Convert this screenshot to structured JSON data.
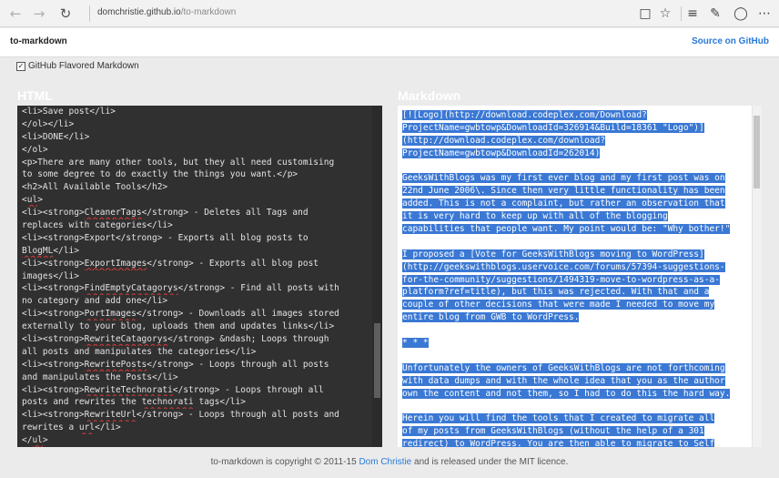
{
  "browser": {
    "address_domain": "domchristie.github.io",
    "address_path": "/to-markdown",
    "icons": [
      "back-arrow-icon",
      "forward-arrow-icon",
      "refresh-icon",
      "reading-view-icon",
      "favorite-star-icon",
      "hub-icon",
      "web-note-icon",
      "share-icon",
      "more-icon"
    ]
  },
  "header": {
    "title": "to-markdown",
    "source_link": "Source on GitHub"
  },
  "options": {
    "gfm_label": "GitHub Flavored Markdown",
    "gfm_checked": true
  },
  "html_panel": {
    "heading": "HTML",
    "lines": [
      [
        {
          "t": "<li>Save post</li>"
        }
      ],
      [
        {
          "t": "</ol></li>"
        }
      ],
      [
        {
          "t": "<li>DONE</li>"
        }
      ],
      [
        {
          "t": "</ol>"
        }
      ],
      [
        {
          "t": "<p>There are many other tools, but they all need customising"
        }
      ],
      [
        {
          "t": "to some degree to do exactly the things you want.</p>"
        }
      ],
      [
        {
          "t": "<h2>All Available Tools</h2>"
        }
      ],
      [
        {
          "t": "<"
        },
        {
          "t": "ul",
          "u": true
        },
        {
          "t": ">"
        }
      ],
      [
        {
          "t": "<li><strong>"
        },
        {
          "t": "CleanerTags",
          "u": true
        },
        {
          "t": "</strong> - Deletes all Tags and"
        }
      ],
      [
        {
          "t": "replaces with categories</li>"
        }
      ],
      [
        {
          "t": "<li><strong>Export</strong> - Exports all blog posts to"
        }
      ],
      [
        {
          "t": "BlogML",
          "u": true
        },
        {
          "t": "</li>"
        }
      ],
      [
        {
          "t": "<li><strong>"
        },
        {
          "t": "ExportImages",
          "u": true
        },
        {
          "t": "</strong> - Exports all blog post"
        }
      ],
      [
        {
          "t": "images</li>"
        }
      ],
      [
        {
          "t": "<li><strong>"
        },
        {
          "t": "FindEmptyCatagorys",
          "u": true
        },
        {
          "t": "</strong> - Find all posts with"
        }
      ],
      [
        {
          "t": "no category and add one</li>"
        }
      ],
      [
        {
          "t": "<li><strong>"
        },
        {
          "t": "PortImages",
          "u": true
        },
        {
          "t": "</strong> - Downloads all images stored"
        }
      ],
      [
        {
          "t": "externally to your blog, uploads them and updates links</li>"
        }
      ],
      [
        {
          "t": "<li><strong>"
        },
        {
          "t": "RewriteCatagorys",
          "u": true
        },
        {
          "t": "</strong> &ndash; Loops through"
        }
      ],
      [
        {
          "t": "all posts and manipulates the categories</li>"
        }
      ],
      [
        {
          "t": "<li><strong>"
        },
        {
          "t": "RewritePosts",
          "u": true
        },
        {
          "t": "</strong> - Loops through all posts"
        }
      ],
      [
        {
          "t": "and manipulates the Posts</li>"
        }
      ],
      [
        {
          "t": "<li><strong>"
        },
        {
          "t": "RewriteTechnorati",
          "u": true
        },
        {
          "t": "</strong> - Loops through all"
        }
      ],
      [
        {
          "t": "posts and rewrites the "
        },
        {
          "t": "technorati",
          "u": true
        },
        {
          "t": " tags</li>"
        }
      ],
      [
        {
          "t": "<li><strong>"
        },
        {
          "t": "RewriteUrl",
          "u": true
        },
        {
          "t": "</strong> - Loops through all posts and"
        }
      ],
      [
        {
          "t": "rewrites a "
        },
        {
          "t": "url",
          "u": true
        },
        {
          "t": "</li>"
        }
      ],
      [
        {
          "t": "</"
        },
        {
          "t": "ul",
          "u": true
        },
        {
          "t": ">"
        }
      ]
    ],
    "scroll_position": 0.82
  },
  "markdown_panel": {
    "heading": "Markdown",
    "lines": [
      "[![Logo](http://download.codeplex.com/Download?",
      "ProjectName=gwbtowp&DownloadId=326914&Build=18361 \"Logo\")]",
      "(http://download.codeplex.com/download?",
      "ProjectName=gwbtowp&DownloadId=262014)",
      "",
      "GeeksWithBlogs was my first ever blog and my first post was on",
      "22nd June 2006\\. Since then very little functionality has been",
      "added. This is not a complaint, but rather an observation that",
      "it is very hard to keep up with all of the blogging",
      "capabilities that people want. My point would be: \"Why bother!\"",
      "",
      "I proposed a [Vote for GeeksWithBlogs moving to WordPress]",
      "(http://geekswithblogs.uservoice.com/forums/57394-suggestions-",
      "for-the-community/suggestions/1494319-move-to-wordpress-as-a-",
      "platform?ref=title), but this was rejected. With that and a",
      "couple of other decisions that were made I needed to move my",
      "entire blog from GWB to WordPress.",
      "",
      "* * *",
      "",
      "Unfortunately the owners of GeeksWithBlogs are not forthcoming",
      "with data dumps and with the whole idea that you as the author",
      "own the content and not them, so I had to do this the hard way.",
      "",
      "Herein you will find the tools that I created to migrate all",
      "of my posts from GeeksWithBlogs (without the help of a 301",
      "redirect) to WordPress. You are then able to migrate to Self"
    ],
    "scroll_position": 0.03
  },
  "footer": {
    "prefix": "to-markdown is copyright © 2011-15",
    "author": "Dom Christie",
    "suffix": "and is released under the MIT licence."
  },
  "colors": {
    "selection": "#3a78d4",
    "link": "#2a7ad8",
    "editor_bg": "#303030"
  }
}
